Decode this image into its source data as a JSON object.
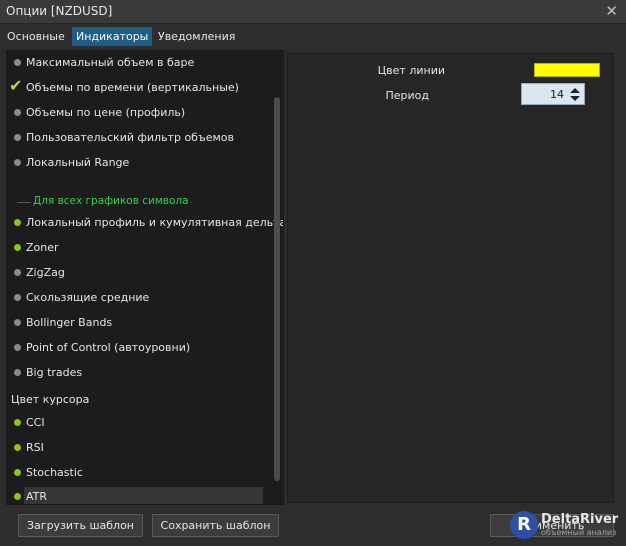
{
  "window": {
    "title": "Опции [NZDUSD]",
    "close": "✕"
  },
  "tabs": [
    {
      "label": "Основные",
      "active": false
    },
    {
      "label": "Индикаторы",
      "active": true
    },
    {
      "label": "Уведомления",
      "active": false
    }
  ],
  "list": {
    "chart_items": [
      {
        "label": "Максимальный объем в баре",
        "state": "inactive"
      },
      {
        "label": "Объемы по времени (вертикальные)",
        "state": "checked"
      },
      {
        "label": "Объемы по цене (профиль)",
        "state": "inactive"
      },
      {
        "label": "Пользовательский фильтр объемов",
        "state": "inactive"
      },
      {
        "label": "Локальный Range",
        "state": "inactive"
      }
    ],
    "symbol_group_label": "Для всех графиков символа",
    "symbol_items": [
      {
        "label": "Локальный профиль и кумулятивная дельта",
        "state": "active"
      },
      {
        "label": "Zoner",
        "state": "active"
      },
      {
        "label": "ZigZag",
        "state": "inactive"
      },
      {
        "label": "Скользящие средние",
        "state": "inactive"
      },
      {
        "label": "Bollinger Bands",
        "state": "inactive"
      },
      {
        "label": "Point of Control (автоуровни)",
        "state": "inactive"
      },
      {
        "label": "Big trades",
        "state": "inactive"
      }
    ],
    "cursor_group_label": "Цвет курсора",
    "cursor_items": [
      {
        "label": "CCI",
        "state": "active"
      },
      {
        "label": "RSI",
        "state": "active"
      },
      {
        "label": "Stochastic",
        "state": "active"
      },
      {
        "label": "ATR",
        "state": "active",
        "selected": true
      }
    ]
  },
  "properties": {
    "line_color_label": "Цвет линии",
    "line_color": "#ffff00",
    "period_label": "Период",
    "period_value": "14"
  },
  "buttons": {
    "load_template": "Загрузить шаблон",
    "save_template": "Сохранить шаблон",
    "apply": "Применить"
  },
  "logo": {
    "badge": "R",
    "name": "DeltaRiver",
    "tagline": "объемный анализ"
  },
  "colors": {
    "accent": "#1e5d86",
    "bullet_active": "#8fc21e",
    "bullet_inactive": "#8a8a8a",
    "check": "#b8d44a",
    "group_label": "#34d24a"
  }
}
